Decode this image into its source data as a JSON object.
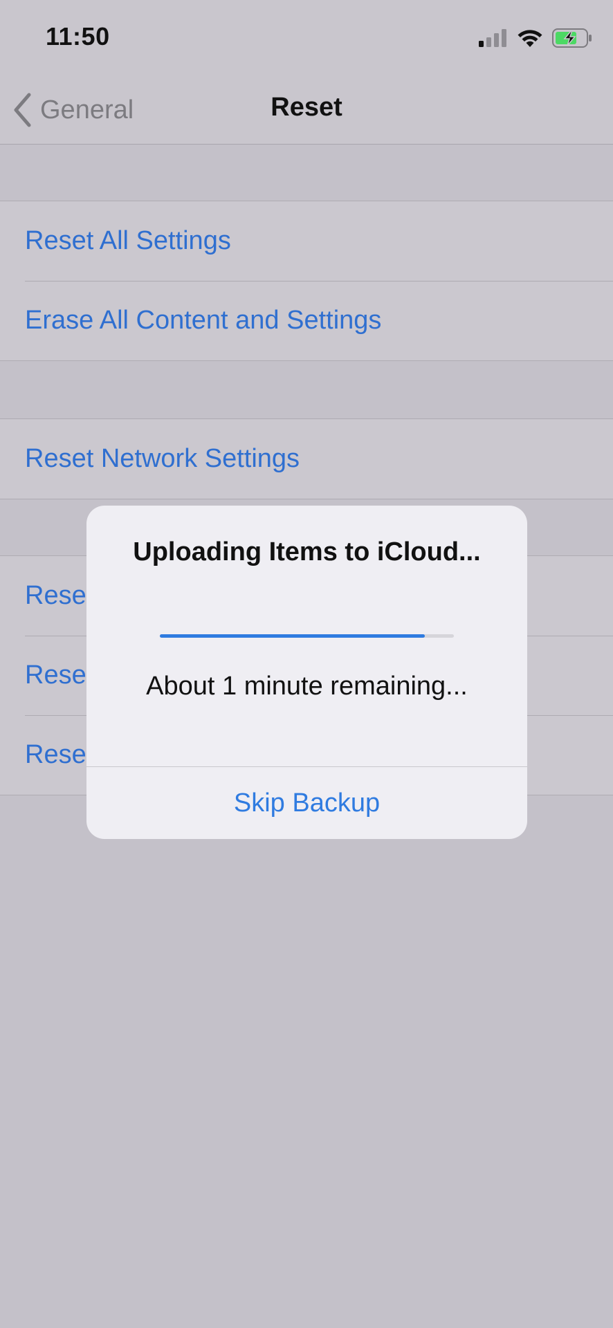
{
  "status_bar": {
    "time": "11:50",
    "icons": [
      "cellular-signal-icon",
      "wifi-icon",
      "battery-charging-icon"
    ]
  },
  "nav": {
    "back_label": "General",
    "title": "Reset"
  },
  "groups": [
    {
      "rows": [
        {
          "label": "Reset All Settings"
        },
        {
          "label": "Erase All Content and Settings"
        }
      ]
    },
    {
      "rows": [
        {
          "label": "Reset Network Settings"
        }
      ]
    },
    {
      "rows": [
        {
          "label": "Rese"
        },
        {
          "label": "Rese"
        },
        {
          "label": "Rese"
        }
      ]
    }
  ],
  "alert": {
    "title": "Uploading Items to iCloud...",
    "progress": 0.9,
    "message": "About 1 minute remaining...",
    "button": "Skip Backup"
  },
  "colors": {
    "link_blue": "#2f6fd0",
    "accent_blue": "#2f7be0",
    "battery_green": "#4cd964"
  }
}
